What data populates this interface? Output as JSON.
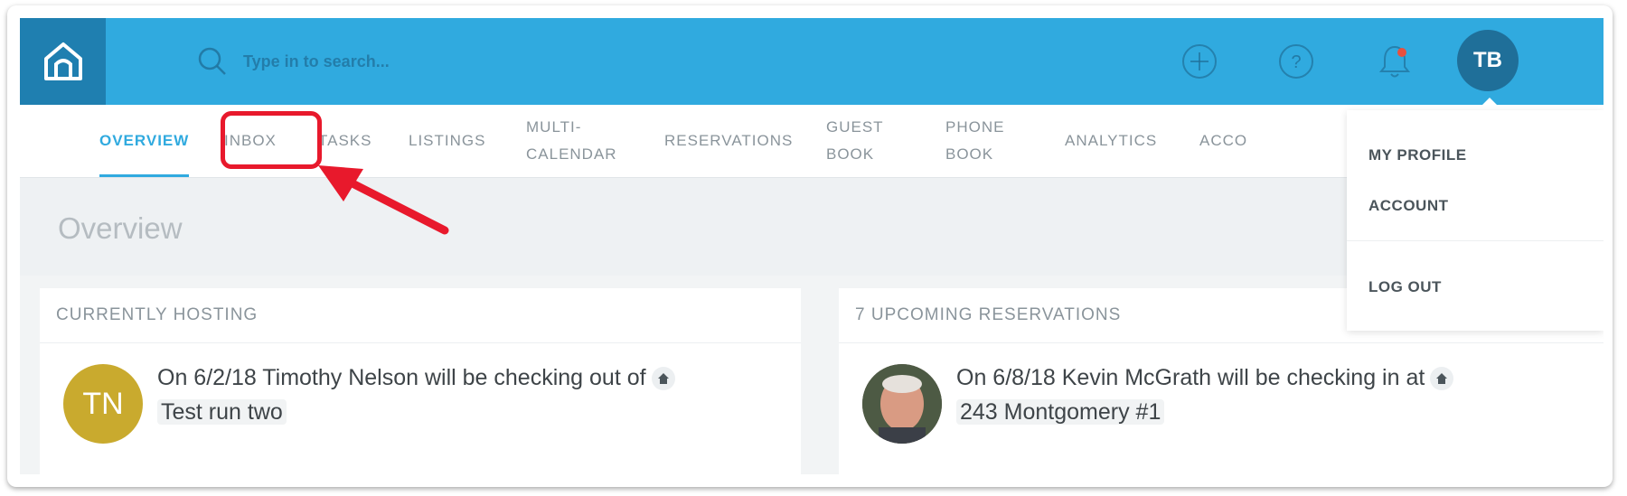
{
  "header": {
    "search": {
      "placeholder": "Type in to search..."
    },
    "avatar_initials": "TB",
    "brand_color": "#30aadf"
  },
  "nav": {
    "items": [
      {
        "label": "OVERVIEW",
        "active": true
      },
      {
        "label": "INBOX",
        "highlighted": true
      },
      {
        "label": "TASKS"
      },
      {
        "label": "LISTINGS"
      },
      {
        "label": "MULTI-\nCALENDAR"
      },
      {
        "label": "RESERVATIONS"
      },
      {
        "label": "GUEST\nBOOK"
      },
      {
        "label": "PHONE\nBOOK"
      },
      {
        "label": "ANALYTICS"
      },
      {
        "label": "ACCO"
      }
    ]
  },
  "page": {
    "title": "Overview"
  },
  "cards": [
    {
      "header": "CURRENTLY HOSTING",
      "row": {
        "avatar_initials": "TN",
        "avatar_color": "#c9aa2e",
        "text": "On 6/2/18 Timothy Nelson will be checking out of",
        "link": "Test run two"
      }
    },
    {
      "header": "7 UPCOMING RESERVATIONS",
      "row": {
        "avatar_kind": "photo",
        "text": "On 6/8/18 Kevin McGrath will be checking in at",
        "link": "243 Montgomery #1"
      }
    }
  ],
  "profile_menu": {
    "items": [
      "MY PROFILE",
      "ACCOUNT",
      "LOG OUT"
    ]
  },
  "annotation": {
    "color": "#e8192c"
  }
}
